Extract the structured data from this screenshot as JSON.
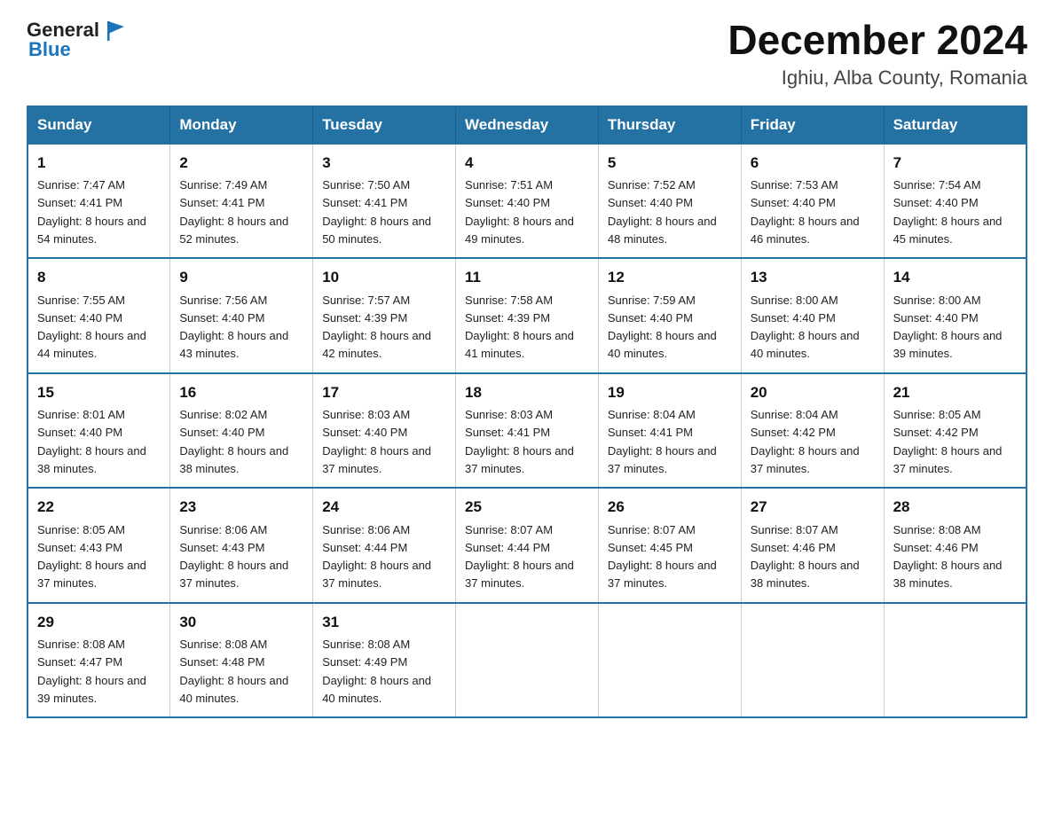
{
  "logo": {
    "text_general": "General",
    "text_blue": "Blue",
    "alt": "GeneralBlue logo"
  },
  "title": "December 2024",
  "subtitle": "Ighiu, Alba County, Romania",
  "headers": [
    "Sunday",
    "Monday",
    "Tuesday",
    "Wednesday",
    "Thursday",
    "Friday",
    "Saturday"
  ],
  "weeks": [
    [
      {
        "day": "1",
        "sunrise": "Sunrise: 7:47 AM",
        "sunset": "Sunset: 4:41 PM",
        "daylight": "Daylight: 8 hours and 54 minutes."
      },
      {
        "day": "2",
        "sunrise": "Sunrise: 7:49 AM",
        "sunset": "Sunset: 4:41 PM",
        "daylight": "Daylight: 8 hours and 52 minutes."
      },
      {
        "day": "3",
        "sunrise": "Sunrise: 7:50 AM",
        "sunset": "Sunset: 4:41 PM",
        "daylight": "Daylight: 8 hours and 50 minutes."
      },
      {
        "day": "4",
        "sunrise": "Sunrise: 7:51 AM",
        "sunset": "Sunset: 4:40 PM",
        "daylight": "Daylight: 8 hours and 49 minutes."
      },
      {
        "day": "5",
        "sunrise": "Sunrise: 7:52 AM",
        "sunset": "Sunset: 4:40 PM",
        "daylight": "Daylight: 8 hours and 48 minutes."
      },
      {
        "day": "6",
        "sunrise": "Sunrise: 7:53 AM",
        "sunset": "Sunset: 4:40 PM",
        "daylight": "Daylight: 8 hours and 46 minutes."
      },
      {
        "day": "7",
        "sunrise": "Sunrise: 7:54 AM",
        "sunset": "Sunset: 4:40 PM",
        "daylight": "Daylight: 8 hours and 45 minutes."
      }
    ],
    [
      {
        "day": "8",
        "sunrise": "Sunrise: 7:55 AM",
        "sunset": "Sunset: 4:40 PM",
        "daylight": "Daylight: 8 hours and 44 minutes."
      },
      {
        "day": "9",
        "sunrise": "Sunrise: 7:56 AM",
        "sunset": "Sunset: 4:40 PM",
        "daylight": "Daylight: 8 hours and 43 minutes."
      },
      {
        "day": "10",
        "sunrise": "Sunrise: 7:57 AM",
        "sunset": "Sunset: 4:39 PM",
        "daylight": "Daylight: 8 hours and 42 minutes."
      },
      {
        "day": "11",
        "sunrise": "Sunrise: 7:58 AM",
        "sunset": "Sunset: 4:39 PM",
        "daylight": "Daylight: 8 hours and 41 minutes."
      },
      {
        "day": "12",
        "sunrise": "Sunrise: 7:59 AM",
        "sunset": "Sunset: 4:40 PM",
        "daylight": "Daylight: 8 hours and 40 minutes."
      },
      {
        "day": "13",
        "sunrise": "Sunrise: 8:00 AM",
        "sunset": "Sunset: 4:40 PM",
        "daylight": "Daylight: 8 hours and 40 minutes."
      },
      {
        "day": "14",
        "sunrise": "Sunrise: 8:00 AM",
        "sunset": "Sunset: 4:40 PM",
        "daylight": "Daylight: 8 hours and 39 minutes."
      }
    ],
    [
      {
        "day": "15",
        "sunrise": "Sunrise: 8:01 AM",
        "sunset": "Sunset: 4:40 PM",
        "daylight": "Daylight: 8 hours and 38 minutes."
      },
      {
        "day": "16",
        "sunrise": "Sunrise: 8:02 AM",
        "sunset": "Sunset: 4:40 PM",
        "daylight": "Daylight: 8 hours and 38 minutes."
      },
      {
        "day": "17",
        "sunrise": "Sunrise: 8:03 AM",
        "sunset": "Sunset: 4:40 PM",
        "daylight": "Daylight: 8 hours and 37 minutes."
      },
      {
        "day": "18",
        "sunrise": "Sunrise: 8:03 AM",
        "sunset": "Sunset: 4:41 PM",
        "daylight": "Daylight: 8 hours and 37 minutes."
      },
      {
        "day": "19",
        "sunrise": "Sunrise: 8:04 AM",
        "sunset": "Sunset: 4:41 PM",
        "daylight": "Daylight: 8 hours and 37 minutes."
      },
      {
        "day": "20",
        "sunrise": "Sunrise: 8:04 AM",
        "sunset": "Sunset: 4:42 PM",
        "daylight": "Daylight: 8 hours and 37 minutes."
      },
      {
        "day": "21",
        "sunrise": "Sunrise: 8:05 AM",
        "sunset": "Sunset: 4:42 PM",
        "daylight": "Daylight: 8 hours and 37 minutes."
      }
    ],
    [
      {
        "day": "22",
        "sunrise": "Sunrise: 8:05 AM",
        "sunset": "Sunset: 4:43 PM",
        "daylight": "Daylight: 8 hours and 37 minutes."
      },
      {
        "day": "23",
        "sunrise": "Sunrise: 8:06 AM",
        "sunset": "Sunset: 4:43 PM",
        "daylight": "Daylight: 8 hours and 37 minutes."
      },
      {
        "day": "24",
        "sunrise": "Sunrise: 8:06 AM",
        "sunset": "Sunset: 4:44 PM",
        "daylight": "Daylight: 8 hours and 37 minutes."
      },
      {
        "day": "25",
        "sunrise": "Sunrise: 8:07 AM",
        "sunset": "Sunset: 4:44 PM",
        "daylight": "Daylight: 8 hours and 37 minutes."
      },
      {
        "day": "26",
        "sunrise": "Sunrise: 8:07 AM",
        "sunset": "Sunset: 4:45 PM",
        "daylight": "Daylight: 8 hours and 37 minutes."
      },
      {
        "day": "27",
        "sunrise": "Sunrise: 8:07 AM",
        "sunset": "Sunset: 4:46 PM",
        "daylight": "Daylight: 8 hours and 38 minutes."
      },
      {
        "day": "28",
        "sunrise": "Sunrise: 8:08 AM",
        "sunset": "Sunset: 4:46 PM",
        "daylight": "Daylight: 8 hours and 38 minutes."
      }
    ],
    [
      {
        "day": "29",
        "sunrise": "Sunrise: 8:08 AM",
        "sunset": "Sunset: 4:47 PM",
        "daylight": "Daylight: 8 hours and 39 minutes."
      },
      {
        "day": "30",
        "sunrise": "Sunrise: 8:08 AM",
        "sunset": "Sunset: 4:48 PM",
        "daylight": "Daylight: 8 hours and 40 minutes."
      },
      {
        "day": "31",
        "sunrise": "Sunrise: 8:08 AM",
        "sunset": "Sunset: 4:49 PM",
        "daylight": "Daylight: 8 hours and 40 minutes."
      },
      null,
      null,
      null,
      null
    ]
  ]
}
